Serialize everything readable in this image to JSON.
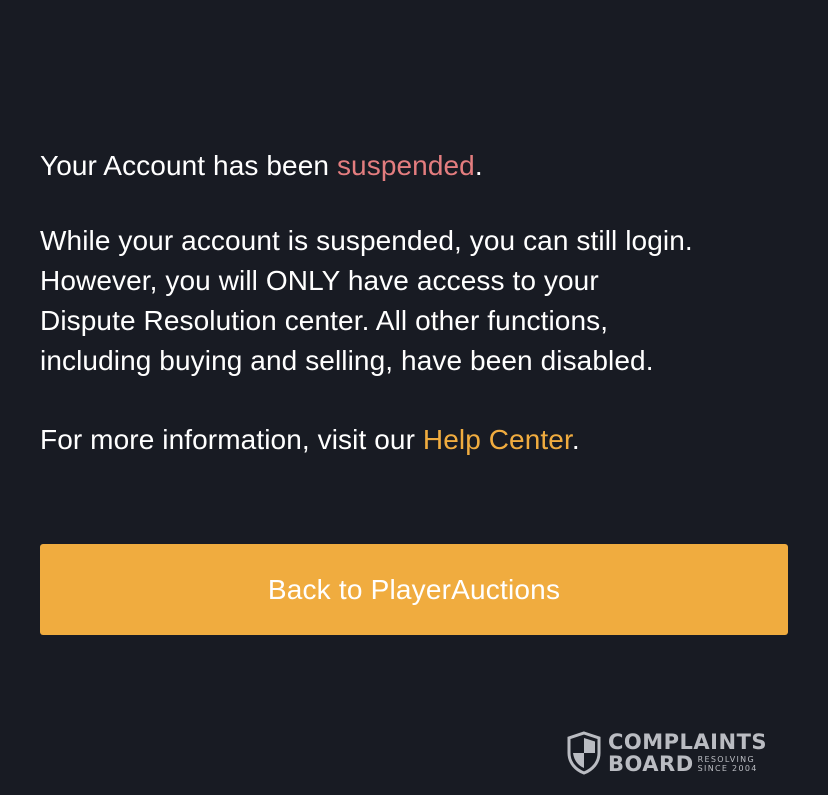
{
  "message": {
    "line1_prefix": "Your Account has been ",
    "line1_status": "suspended",
    "line1_suffix": ".",
    "details_lines": [
      "While your account is suspended, you can still login.",
      "However, you will ONLY have access to your",
      "Dispute Resolution center. All other functions,",
      "including buying and selling, have been disabled."
    ],
    "info_prefix": "For more information, visit our ",
    "info_link": "Help Center",
    "info_suffix": "."
  },
  "button": {
    "label": "Back to PlayerAuctions"
  },
  "watermark": {
    "line1": "COMPLAINTS",
    "line2": "BOARD",
    "tag1": "RESOLVING",
    "tag2": "SINCE 2004"
  },
  "colors": {
    "background": "#181b23",
    "status_red": "#e37d7f",
    "accent_orange": "#f0ac3f"
  }
}
